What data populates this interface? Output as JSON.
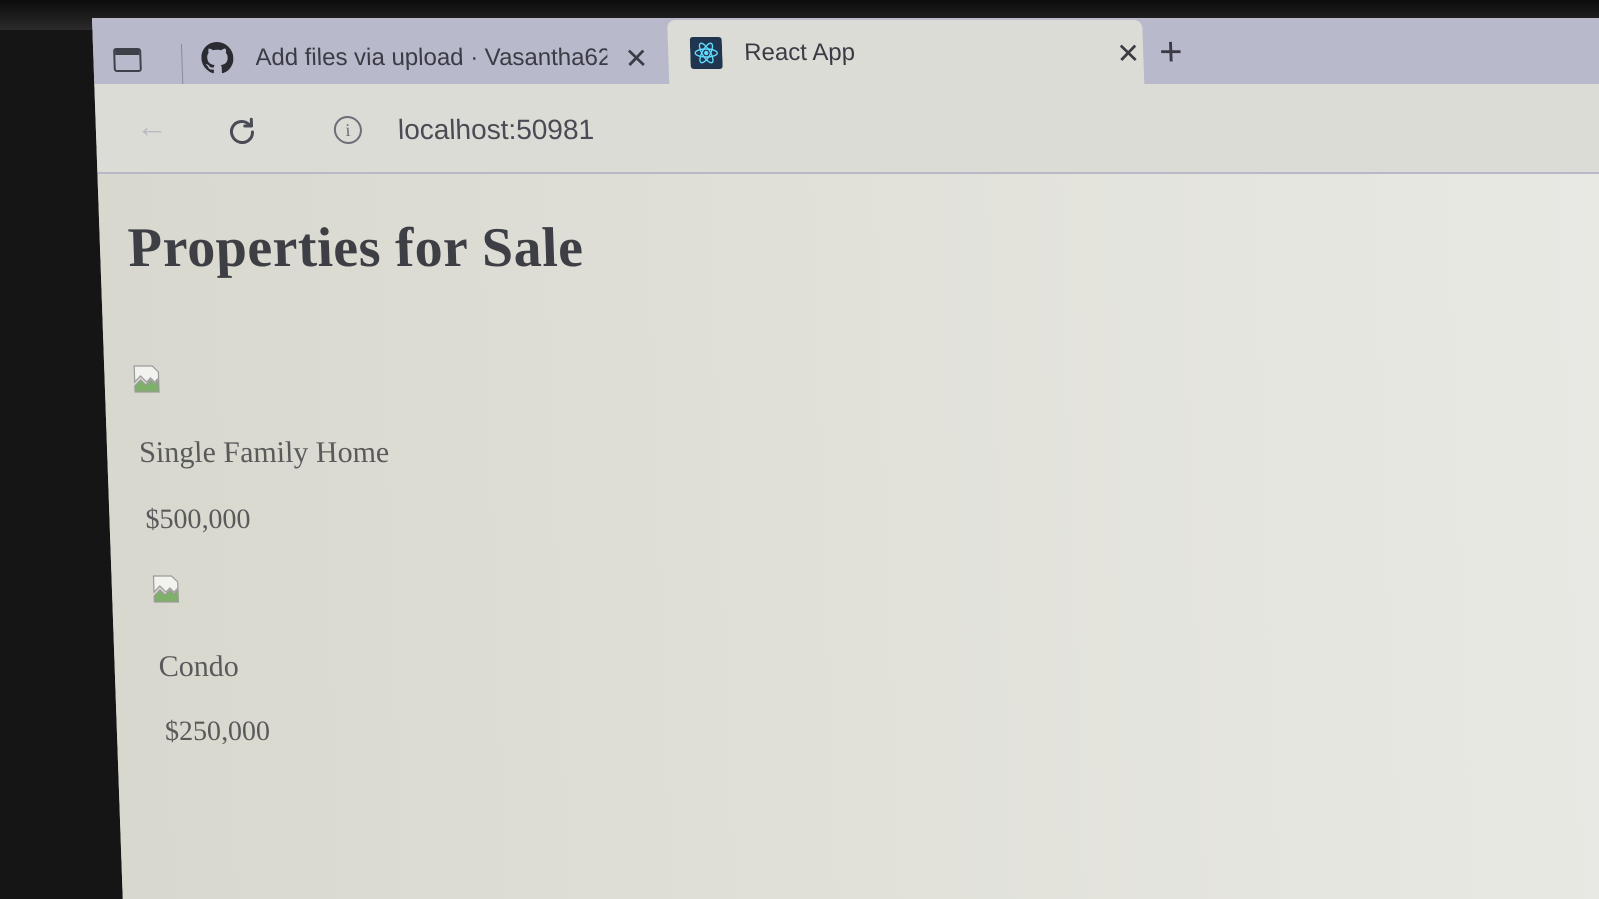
{
  "browser": {
    "tabs": [
      {
        "title": "Add files via upload · Vasantha62",
        "favicon": "github-icon",
        "active": false
      },
      {
        "title": "React App",
        "favicon": "react-icon",
        "active": true
      }
    ],
    "address": "localhost:50981"
  },
  "page": {
    "heading": "Properties for Sale",
    "properties": [
      {
        "name": "Single Family Home",
        "price": "$500,000",
        "image": "broken-image-icon"
      },
      {
        "name": "Condo",
        "price": "$250,000",
        "image": "broken-image-icon"
      }
    ]
  }
}
